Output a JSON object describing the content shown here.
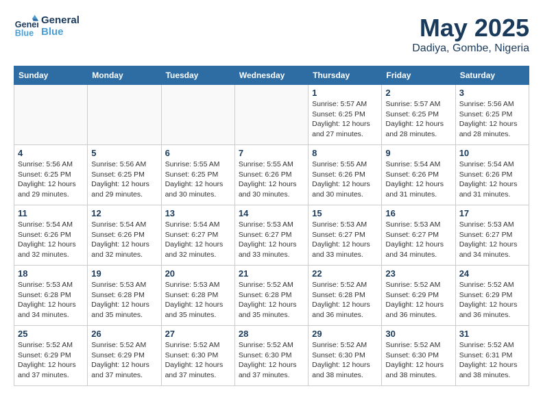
{
  "logo": {
    "line1": "General",
    "line2": "Blue"
  },
  "title": "May 2025",
  "subtitle": "Dadiya, Gombe, Nigeria",
  "days_of_week": [
    "Sunday",
    "Monday",
    "Tuesday",
    "Wednesday",
    "Thursday",
    "Friday",
    "Saturday"
  ],
  "weeks": [
    [
      {
        "day": "",
        "info": ""
      },
      {
        "day": "",
        "info": ""
      },
      {
        "day": "",
        "info": ""
      },
      {
        "day": "",
        "info": ""
      },
      {
        "day": "1",
        "info": "Sunrise: 5:57 AM\nSunset: 6:25 PM\nDaylight: 12 hours\nand 27 minutes."
      },
      {
        "day": "2",
        "info": "Sunrise: 5:57 AM\nSunset: 6:25 PM\nDaylight: 12 hours\nand 28 minutes."
      },
      {
        "day": "3",
        "info": "Sunrise: 5:56 AM\nSunset: 6:25 PM\nDaylight: 12 hours\nand 28 minutes."
      }
    ],
    [
      {
        "day": "4",
        "info": "Sunrise: 5:56 AM\nSunset: 6:25 PM\nDaylight: 12 hours\nand 29 minutes."
      },
      {
        "day": "5",
        "info": "Sunrise: 5:56 AM\nSunset: 6:25 PM\nDaylight: 12 hours\nand 29 minutes."
      },
      {
        "day": "6",
        "info": "Sunrise: 5:55 AM\nSunset: 6:25 PM\nDaylight: 12 hours\nand 30 minutes."
      },
      {
        "day": "7",
        "info": "Sunrise: 5:55 AM\nSunset: 6:26 PM\nDaylight: 12 hours\nand 30 minutes."
      },
      {
        "day": "8",
        "info": "Sunrise: 5:55 AM\nSunset: 6:26 PM\nDaylight: 12 hours\nand 30 minutes."
      },
      {
        "day": "9",
        "info": "Sunrise: 5:54 AM\nSunset: 6:26 PM\nDaylight: 12 hours\nand 31 minutes."
      },
      {
        "day": "10",
        "info": "Sunrise: 5:54 AM\nSunset: 6:26 PM\nDaylight: 12 hours\nand 31 minutes."
      }
    ],
    [
      {
        "day": "11",
        "info": "Sunrise: 5:54 AM\nSunset: 6:26 PM\nDaylight: 12 hours\nand 32 minutes."
      },
      {
        "day": "12",
        "info": "Sunrise: 5:54 AM\nSunset: 6:26 PM\nDaylight: 12 hours\nand 32 minutes."
      },
      {
        "day": "13",
        "info": "Sunrise: 5:54 AM\nSunset: 6:27 PM\nDaylight: 12 hours\nand 32 minutes."
      },
      {
        "day": "14",
        "info": "Sunrise: 5:53 AM\nSunset: 6:27 PM\nDaylight: 12 hours\nand 33 minutes."
      },
      {
        "day": "15",
        "info": "Sunrise: 5:53 AM\nSunset: 6:27 PM\nDaylight: 12 hours\nand 33 minutes."
      },
      {
        "day": "16",
        "info": "Sunrise: 5:53 AM\nSunset: 6:27 PM\nDaylight: 12 hours\nand 34 minutes."
      },
      {
        "day": "17",
        "info": "Sunrise: 5:53 AM\nSunset: 6:27 PM\nDaylight: 12 hours\nand 34 minutes."
      }
    ],
    [
      {
        "day": "18",
        "info": "Sunrise: 5:53 AM\nSunset: 6:28 PM\nDaylight: 12 hours\nand 34 minutes."
      },
      {
        "day": "19",
        "info": "Sunrise: 5:53 AM\nSunset: 6:28 PM\nDaylight: 12 hours\nand 35 minutes."
      },
      {
        "day": "20",
        "info": "Sunrise: 5:53 AM\nSunset: 6:28 PM\nDaylight: 12 hours\nand 35 minutes."
      },
      {
        "day": "21",
        "info": "Sunrise: 5:52 AM\nSunset: 6:28 PM\nDaylight: 12 hours\nand 35 minutes."
      },
      {
        "day": "22",
        "info": "Sunrise: 5:52 AM\nSunset: 6:28 PM\nDaylight: 12 hours\nand 36 minutes."
      },
      {
        "day": "23",
        "info": "Sunrise: 5:52 AM\nSunset: 6:29 PM\nDaylight: 12 hours\nand 36 minutes."
      },
      {
        "day": "24",
        "info": "Sunrise: 5:52 AM\nSunset: 6:29 PM\nDaylight: 12 hours\nand 36 minutes."
      }
    ],
    [
      {
        "day": "25",
        "info": "Sunrise: 5:52 AM\nSunset: 6:29 PM\nDaylight: 12 hours\nand 37 minutes."
      },
      {
        "day": "26",
        "info": "Sunrise: 5:52 AM\nSunset: 6:29 PM\nDaylight: 12 hours\nand 37 minutes."
      },
      {
        "day": "27",
        "info": "Sunrise: 5:52 AM\nSunset: 6:30 PM\nDaylight: 12 hours\nand 37 minutes."
      },
      {
        "day": "28",
        "info": "Sunrise: 5:52 AM\nSunset: 6:30 PM\nDaylight: 12 hours\nand 37 minutes."
      },
      {
        "day": "29",
        "info": "Sunrise: 5:52 AM\nSunset: 6:30 PM\nDaylight: 12 hours\nand 38 minutes."
      },
      {
        "day": "30",
        "info": "Sunrise: 5:52 AM\nSunset: 6:30 PM\nDaylight: 12 hours\nand 38 minutes."
      },
      {
        "day": "31",
        "info": "Sunrise: 5:52 AM\nSunset: 6:31 PM\nDaylight: 12 hours\nand 38 minutes."
      }
    ]
  ]
}
